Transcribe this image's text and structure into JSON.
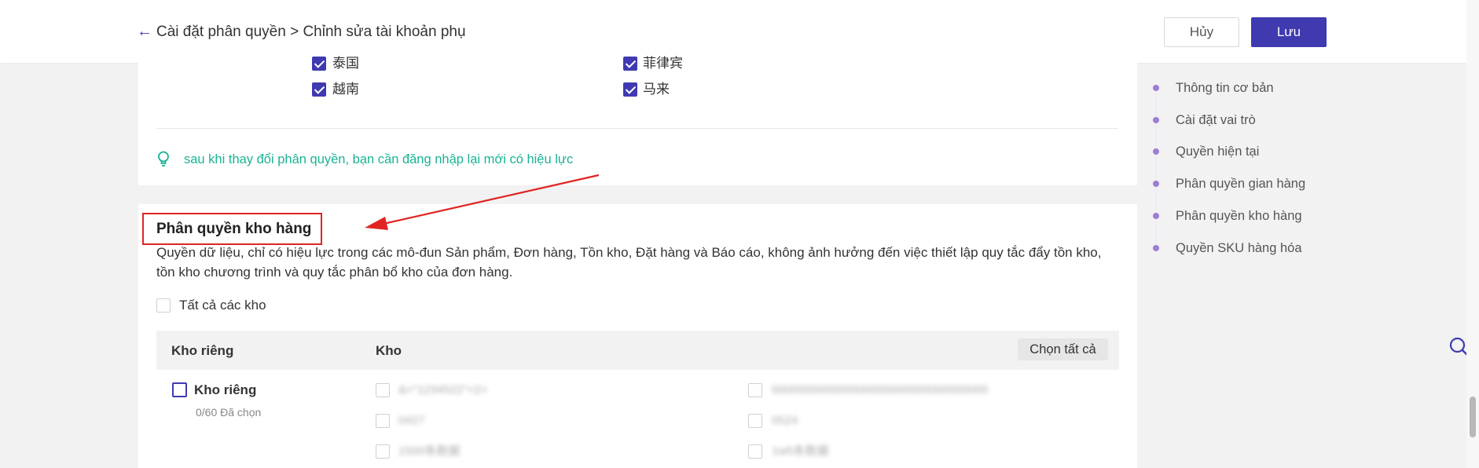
{
  "header": {
    "back_icon": "arrow-left-icon",
    "breadcrumb": "Cài đặt phân quyền > Chỉnh sửa tài khoản phụ",
    "cancel_label": "Hủy",
    "save_label": "Lưu"
  },
  "regions": [
    {
      "label": "泰国",
      "checked": true
    },
    {
      "label": "菲律宾",
      "checked": true
    },
    {
      "label": "越南",
      "checked": true
    },
    {
      "label": "马来",
      "checked": true
    }
  ],
  "tip": {
    "icon": "lightbulb-icon",
    "text": "sau khi thay đổi phân quyền, bạn cần đăng nhập lại mới có hiệu lực"
  },
  "warehouse": {
    "title": "Phân quyền kho hàng",
    "description": "Quyền dữ liệu, chỉ có hiệu lực trong các mô-đun Sản phẩm, Đơn hàng, Tồn kho, Đặt hàng và Báo cáo, không ảnh hưởng đến việc thiết lập quy tắc đẩy tồn kho, tồn kho chương trình và quy tắc phân bổ kho của đơn hàng.",
    "all_label": "Tất cả các kho",
    "col_private": "Kho riêng",
    "col_warehouse": "Kho",
    "select_all_label": "Chọn tất cả",
    "group_label": "Kho riêng",
    "group_count": "0/60 Đã chọn",
    "items": [
      "&=\"1234522\"<2>",
      "000000000000000000000000000000000",
      "0427",
      "0524",
      "1500条数据",
      "1w5条数据"
    ]
  },
  "anchor_nav": {
    "items": [
      "Thông tin cơ bản",
      "Cài đặt vai trò",
      "Quyền hiện tại",
      "Phân quyền gian hàng",
      "Phân quyền kho hàng",
      "Quyền SKU hàng hóa"
    ]
  },
  "colors": {
    "primary": "#3f3ab0",
    "tip": "#19b394",
    "annotation": "#e02424"
  },
  "icons": {
    "floating_search": "search-icon"
  }
}
